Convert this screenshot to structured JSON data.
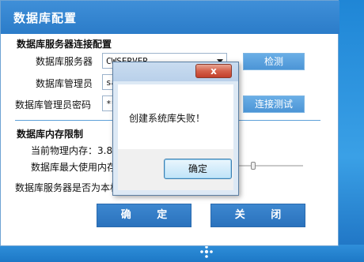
{
  "window": {
    "title": "数据库配置"
  },
  "connection": {
    "section_title": "数据库服务器连接配置",
    "server_label": "数据库服务器",
    "server_value": "CWSERVER",
    "detect_button": "检测",
    "admin_label": "数据库管理员",
    "admin_value": "sa",
    "password_label": "数据库管理员密码",
    "password_value": "**",
    "test_button": "连接测试"
  },
  "memory": {
    "section_title": "数据库内存限制",
    "current_label": "当前物理内存：3.8",
    "max_label": "数据库最大使用内存",
    "local_label": "数据库服务器是否为本机"
  },
  "footer": {
    "ok_button": "确 定",
    "close_button": "关 闭"
  },
  "dialog": {
    "close_glyph": "x",
    "message": "创建系统库失败！",
    "ok_button": "确定"
  }
}
